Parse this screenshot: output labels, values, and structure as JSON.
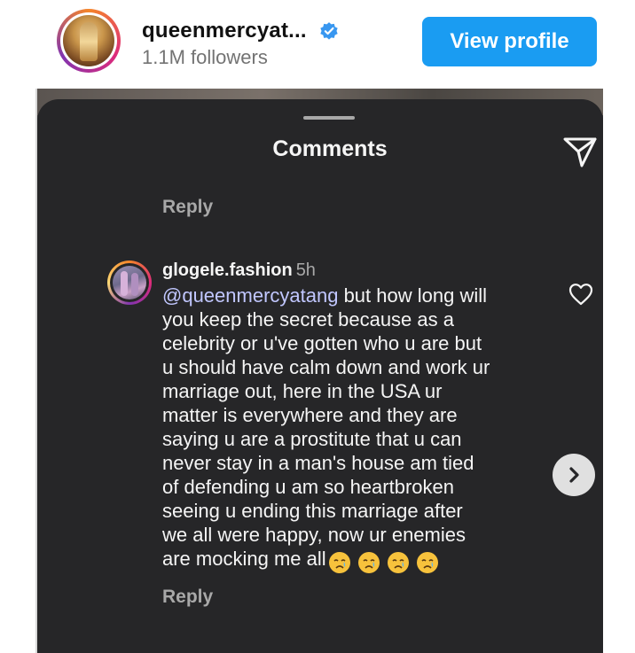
{
  "profile": {
    "username": "queenmercyat...",
    "followers": "1.1M followers",
    "view_profile_label": "View profile",
    "verified_color": "#3897f0",
    "button_color": "#1a9cf2"
  },
  "sheet": {
    "title": "Comments",
    "reply_top_label": "Reply",
    "background_color": "#262628"
  },
  "comment": {
    "author": "glogele.fashion",
    "time": "5h",
    "mention": "@queenmercyatang",
    "lines": [
      " but how long will",
      "you keep the secret because as a",
      "celebrity or u've gotten who u are but",
      "u should have calm down and work ur",
      "marriage out, here in the USA ur",
      "matter is everywhere and they are",
      "saying u are a prostitute that u can",
      "never stay in a man's house am tied",
      "of defending u am so heartbroken",
      "seeing u ending this marriage after",
      "we all were happy, now ur enemies",
      "are mocking me all"
    ],
    "emojis": [
      "crying-face",
      "crying-face",
      "crying-face",
      "crying-face"
    ],
    "reply_label": "Reply",
    "mention_color": "#c1c7ff"
  },
  "icons": {
    "share": "paper-plane-icon",
    "like": "heart-outline-icon",
    "next": "chevron-right-icon",
    "verified": "verified-badge-icon"
  }
}
